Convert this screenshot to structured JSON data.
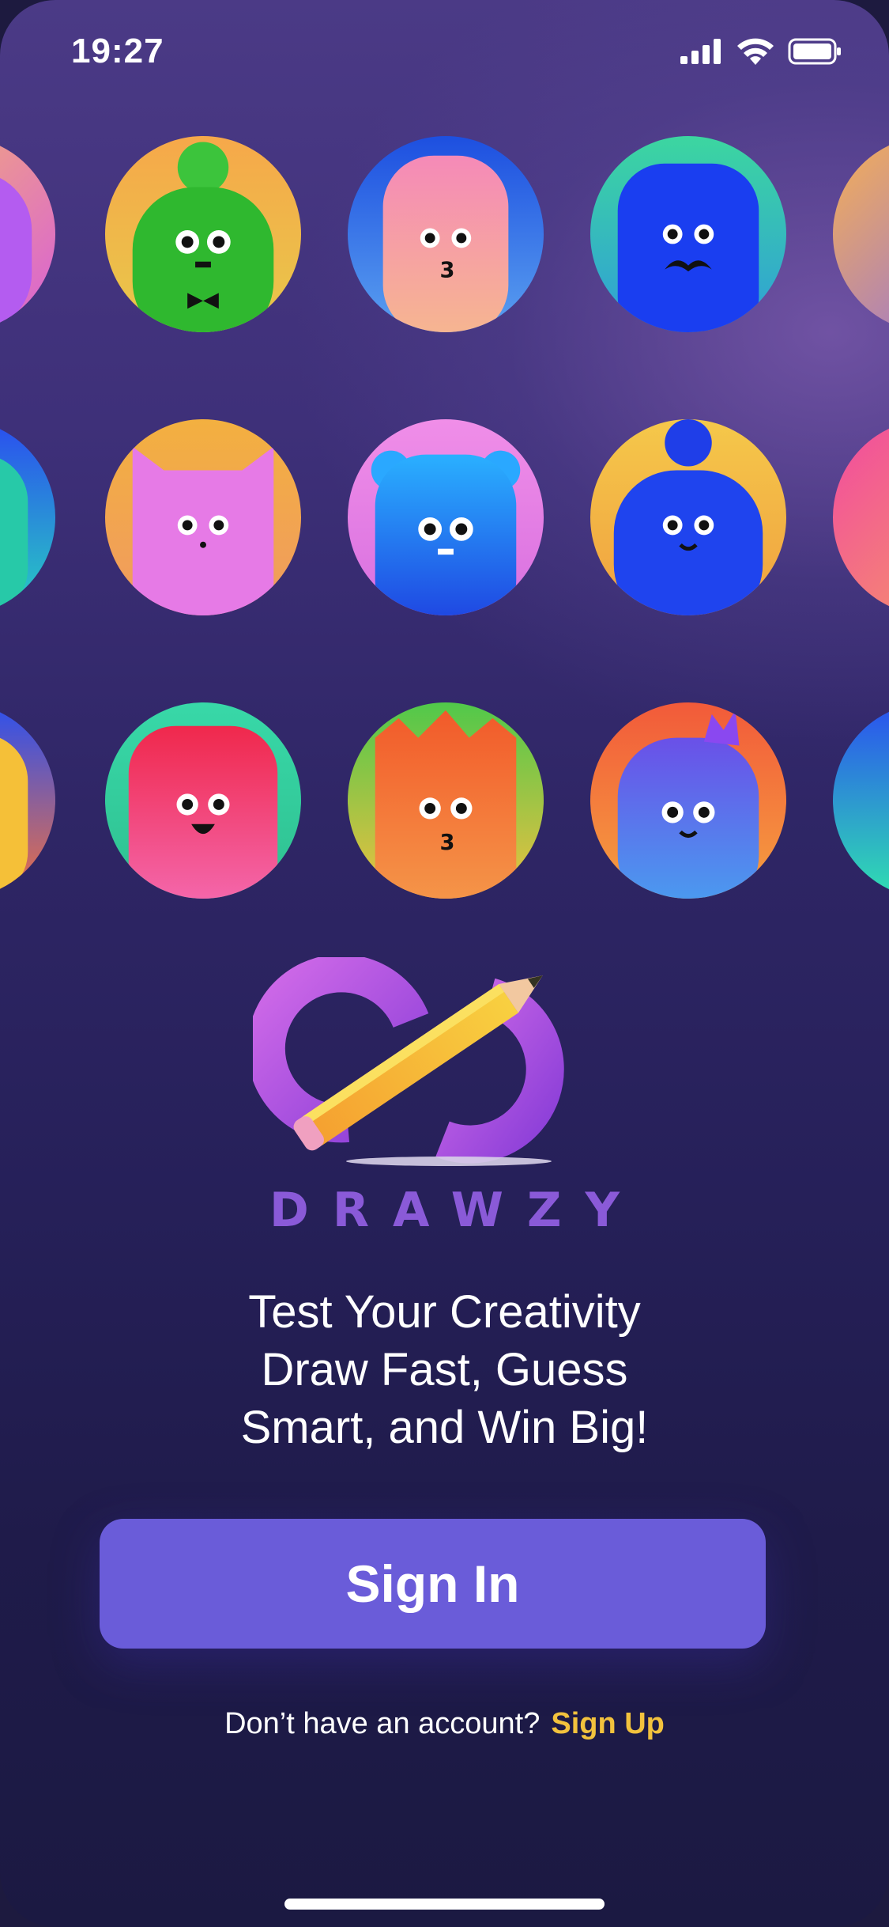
{
  "status_bar": {
    "time": "19:27",
    "icons": [
      "signal-icon",
      "wifi-icon",
      "battery-icon"
    ]
  },
  "avatars": {
    "rows": [
      [
        "purple-avatar",
        "green-bowtie-avatar",
        "pink-kiss-avatar",
        "blue-mustache-avatar",
        "orange-avatar"
      ],
      [
        "blue-avatar",
        "pink-cat-avatar",
        "blue-bear-avatar",
        "blue-bun-avatar",
        "pink-avatar"
      ],
      [
        "yellow-avatar",
        "red-happy-avatar",
        "orange-spiky-avatar",
        "blue-crown-avatar",
        "teal-avatar"
      ]
    ]
  },
  "brand": {
    "name": "DRAWZY",
    "logo_icon": "infinity-pencil-logo"
  },
  "tagline": {
    "line1": "Test Your Creativity",
    "line2": "Draw Fast, Guess",
    "line3": "Smart, and Win Big!"
  },
  "signin": {
    "label": "Sign In"
  },
  "signup": {
    "prompt": "Don’t have an account?",
    "link": "Sign Up"
  },
  "colors": {
    "accent": "#6a5cd9",
    "link": "#f2c23d",
    "brand": "#8a5ad8",
    "background": "#1f1b4a"
  }
}
